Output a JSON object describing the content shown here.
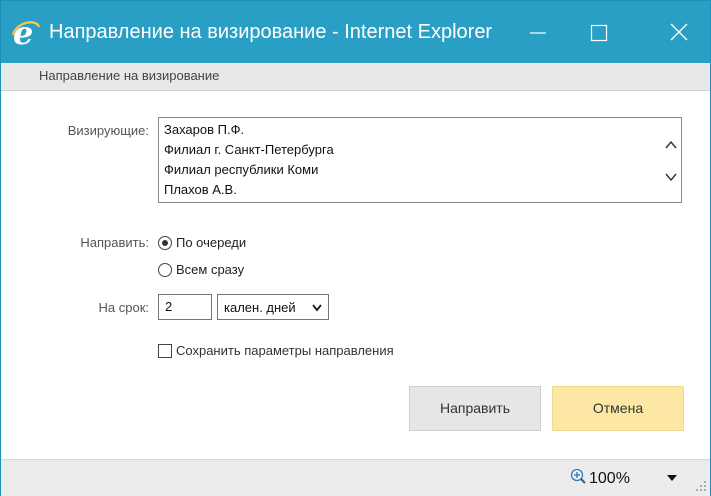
{
  "window": {
    "title": "Направление на визирование - Internet Explorer"
  },
  "subheader": {
    "title": "Направление на визирование"
  },
  "form": {
    "approvers_label": "Визирующие:",
    "approvers": [
      "Захаров П.Ф.",
      "Филиал г. Санкт-Петербурга",
      "Филиал республики Коми",
      "Плахов А.В."
    ],
    "send_label": "Направить:",
    "send_options": [
      {
        "label": "По очереди",
        "checked": true
      },
      {
        "label": "Всем сразу",
        "checked": false
      }
    ],
    "term_label": "На срок:",
    "term_value": "2",
    "term_unit": "кален. дней",
    "save_params_label": "Сохранить параметры направления",
    "save_params_checked": false
  },
  "buttons": {
    "send": "Направить",
    "cancel": "Отмена"
  },
  "statusbar": {
    "zoom": "100%"
  },
  "colors": {
    "titlebar": "#2a9fc6",
    "cancel_button": "#fce8a4",
    "send_button": "#e6e6e6"
  },
  "icons": [
    "ie-logo-icon",
    "minimize-icon",
    "maximize-icon",
    "close-icon",
    "scroll-up-icon",
    "scroll-down-icon",
    "chevron-down-icon",
    "zoom-icon",
    "dropdown-arrow-icon",
    "resize-grip-icon"
  ]
}
